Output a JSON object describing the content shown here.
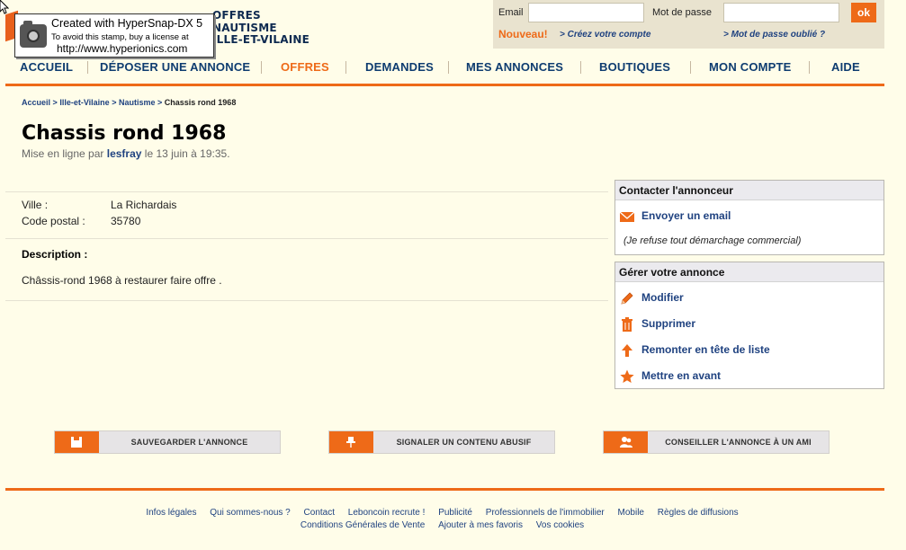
{
  "stamp": {
    "line1": "Created with HyperSnap-DX 5",
    "line2": "To avoid this stamp, buy a license at",
    "line3": "http://www.hyperionics.com"
  },
  "site": {
    "title_lines": [
      "OFFRES",
      "NAUTISME",
      "ILLE-ET-VILAINE"
    ]
  },
  "login": {
    "email_label": "Email",
    "password_label": "Mot de passe",
    "ok_label": "ok",
    "nouveau_label": "Nouveau!",
    "create_account_link": "> Créez votre compte",
    "forgot_password_link": "> Mot de passe oublié ?"
  },
  "nav": {
    "items": [
      "ACCUEIL",
      "DÉPOSER UNE ANNONCE",
      "OFFRES",
      "DEMANDES",
      "MES ANNONCES",
      "BOUTIQUES",
      "MON COMPTE",
      "AIDE"
    ],
    "active": "OFFRES"
  },
  "breadcrumb": {
    "items": [
      "Accueil",
      "Ille-et-Vilaine",
      "Nautisme"
    ],
    "separator": ">",
    "current": "Chassis rond 1968"
  },
  "ad": {
    "title": "Chassis rond 1968",
    "posted_prefix": "Mise en ligne par",
    "author": "lesfray",
    "posted_suffix": "le 13 juin à 19:35.",
    "city_label": "Ville :",
    "city_value": "La Richardais",
    "postal_label": "Code postal :",
    "postal_value": "35780",
    "description_label": "Description :",
    "description_text": "Châssis-rond 1968 à restaurer faire offre ."
  },
  "contact_panel": {
    "title": "Contacter l'annonceur",
    "email_action": "Envoyer un email",
    "note": "(Je refuse tout démarchage commercial)"
  },
  "manage_panel": {
    "title": "Gérer votre annonce",
    "actions": [
      "Modifier",
      "Supprimer",
      "Remonter en tête de liste",
      "Mettre en avant"
    ]
  },
  "bottom_actions": {
    "save": "SAUVEGARDER L'ANNONCE",
    "report": "SIGNALER UN CONTENU ABUSIF",
    "share": "CONSEILLER L'ANNONCE À UN AMI"
  },
  "footer": {
    "row1": [
      "Infos légales",
      "Qui sommes-nous ?",
      "Contact",
      "Leboncoin recrute !",
      "Publicité",
      "Professionnels de l'immobilier",
      "Mobile",
      "Règles de diffusions"
    ],
    "row2": [
      "Conditions Générales de Vente",
      "Ajouter à mes favoris",
      "Vos cookies"
    ]
  },
  "colors": {
    "accent": "#ee6a18",
    "link": "#1f4280",
    "nav": "#0e3c70",
    "background": "#fffde9"
  }
}
